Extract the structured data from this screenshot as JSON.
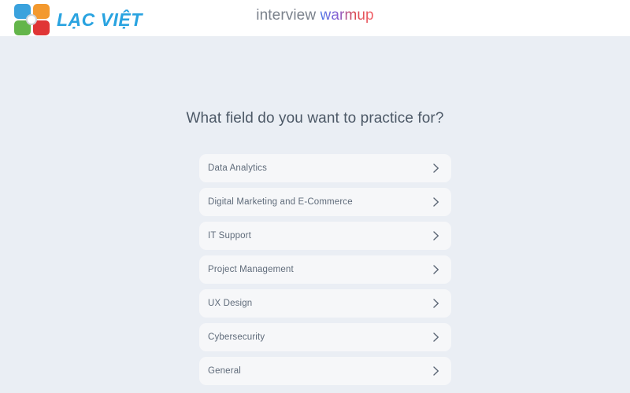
{
  "header": {
    "brand": {
      "name": "LẠC VIỆT",
      "logo_icon": "lacviet-four-squares-logo",
      "colors": {
        "top_left": "#3aa2dd",
        "top_right": "#f3992f",
        "bottom_left": "#63b54a",
        "bottom_right": "#e03535",
        "wordmark": "#29a3e0"
      }
    },
    "app_title": {
      "plain_part": "interview ",
      "gradient_part": "warmup",
      "plain_color": "#7b828c",
      "gradient_from": "#4e76e8",
      "gradient_to": "#f2636a"
    },
    "background": "#ffffff"
  },
  "main": {
    "question": "What field do you want to practice for?",
    "question_color": "#4c5866",
    "background": "#eaeef4",
    "option_background": "#f6f7f9",
    "option_text_color": "#5f6b7a",
    "chevron_icon": "chevron-right-icon",
    "options": [
      {
        "label": "Data Analytics"
      },
      {
        "label": "Digital Marketing and E-Commerce"
      },
      {
        "label": "IT Support"
      },
      {
        "label": "Project Management"
      },
      {
        "label": "UX Design"
      },
      {
        "label": "Cybersecurity"
      },
      {
        "label": "General"
      }
    ]
  }
}
